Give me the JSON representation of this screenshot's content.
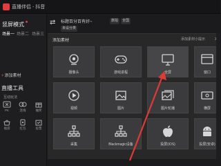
{
  "window": {
    "title": "直播伴侣 - 抖音"
  },
  "left_panel": {
    "mode_title": "竖屏模式",
    "scene_tabs": [
      "场景一",
      "场景二",
      "场景三"
    ],
    "add_source": "添加素材",
    "tools_title": "直播工具",
    "tools_subtitle": "互动玩法",
    "tools": [
      {
        "label": "PK",
        "icon": "pk-icon"
      },
      {
        "label": "连线",
        "icon": "link-icon"
      },
      {
        "label": "抽奖",
        "icon": "gift-icon"
      },
      {
        "label": "福袋",
        "icon": "bag-icon"
      },
      {
        "label": "红包",
        "icon": "redpacket-icon"
      },
      {
        "label": "投票",
        "icon": "vote-icon"
      }
    ]
  },
  "toolbar": {
    "title_label": "标题百分百有好~",
    "tag_category": "旅拍",
    "tag_region": "全国",
    "tag_unset": "未设分类"
  },
  "dialog": {
    "title": "添加素材",
    "help": "添加素材小提示",
    "close": "×",
    "tiles": [
      {
        "label": "摄像头",
        "icon": "camera-icon"
      },
      {
        "label": "游戏进程",
        "icon": "gamepad-icon"
      },
      {
        "label": "全屏",
        "icon": "monitor-icon"
      },
      {
        "label": "窗口",
        "icon": "window-icon"
      },
      {
        "label": "视频",
        "icon": "play-icon"
      },
      {
        "label": "图片",
        "icon": "image-icon"
      },
      {
        "label": "图片轮播",
        "icon": "image-carousel-icon"
      },
      {
        "label": "横屏",
        "icon": "landscape-icon"
      },
      {
        "label": "采集",
        "icon": "capture-icon"
      },
      {
        "label": "Blackmagic设备",
        "icon": "blackmagic-icon"
      },
      {
        "label": "投屏(iOS)",
        "icon": "apple-icon"
      },
      {
        "label": "投屏(安卓)",
        "icon": "android-icon"
      }
    ]
  },
  "colors": {
    "accent": "#e23b3b",
    "arrow": "#e03a36",
    "tile": "#3b3b3d",
    "dialog": "#282829"
  }
}
